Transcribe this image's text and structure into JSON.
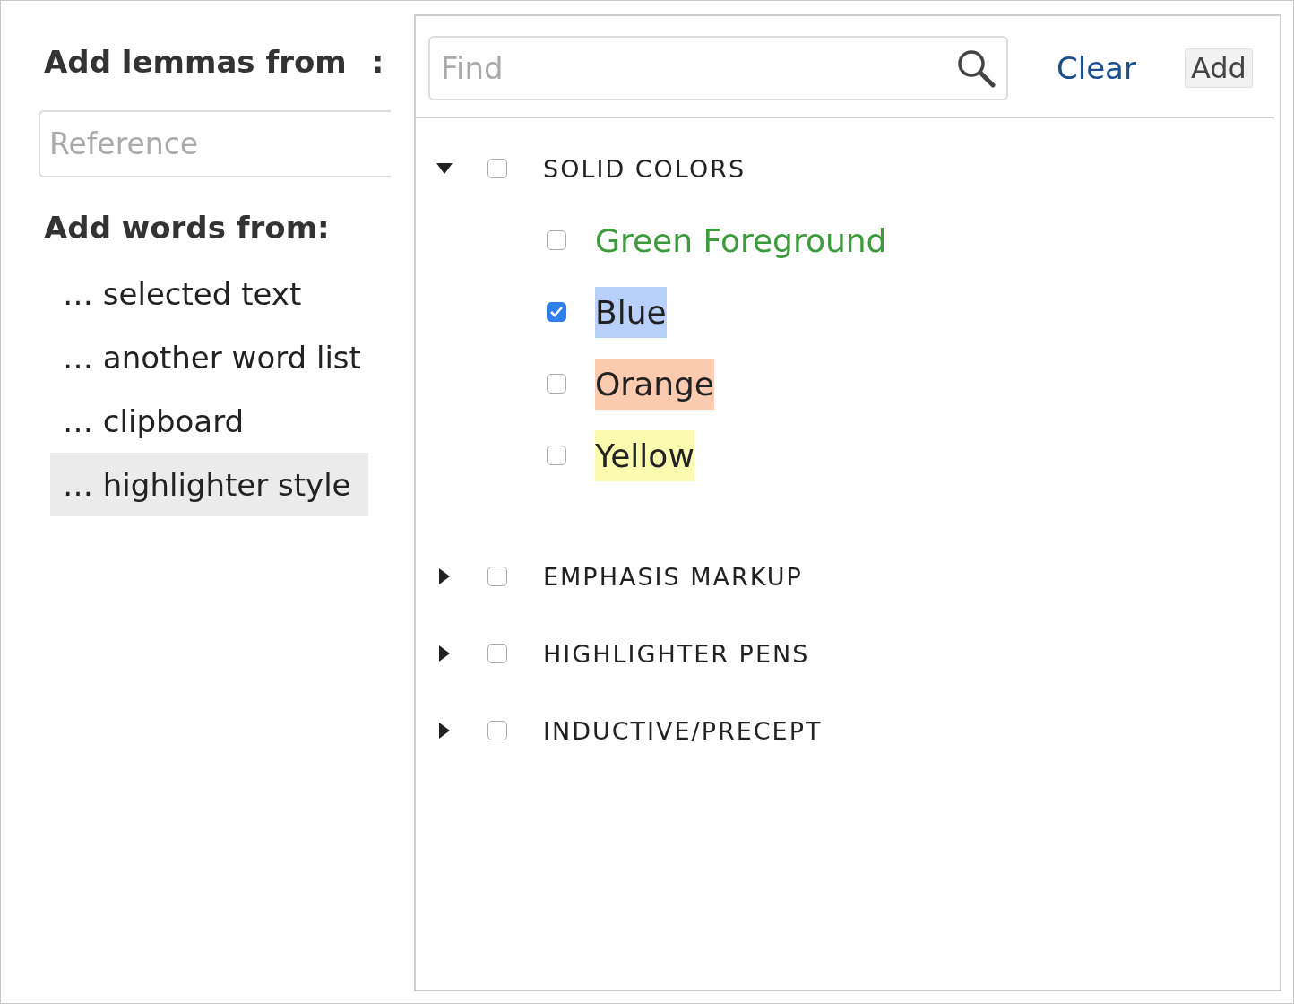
{
  "left": {
    "lemmas_label": "Add lemmas from",
    "lemmas_colon": ":",
    "reference": {
      "placeholder": "Reference"
    },
    "words_label": "Add words from:",
    "sources": [
      {
        "label": "… selected text",
        "selected": false
      },
      {
        "label": "… another word list",
        "selected": false
      },
      {
        "label": "… clipboard",
        "selected": false
      },
      {
        "label": "… highlighter style",
        "selected": true
      }
    ]
  },
  "right": {
    "find": {
      "placeholder": "Find"
    },
    "clear": "Clear",
    "add": "Add",
    "groups": [
      {
        "label": "SOLID COLORS",
        "expanded": true,
        "checked": false,
        "children": [
          {
            "label": "Green Foreground",
            "checked": false,
            "kind": "foreground",
            "color": "#3d9a3d"
          },
          {
            "label": "Blue",
            "checked": true,
            "kind": "background",
            "color": "#b9d0fb"
          },
          {
            "label": "Orange",
            "checked": false,
            "kind": "background",
            "color": "#fbcbb0"
          },
          {
            "label": "Yellow",
            "checked": false,
            "kind": "background",
            "color": "#fbfbb0"
          }
        ]
      },
      {
        "label": "EMPHASIS MARKUP",
        "expanded": false,
        "checked": false
      },
      {
        "label": "HIGHLIGHTER PENS",
        "expanded": false,
        "checked": false
      },
      {
        "label": "INDUCTIVE/PRECEPT",
        "expanded": false,
        "checked": false
      }
    ]
  }
}
